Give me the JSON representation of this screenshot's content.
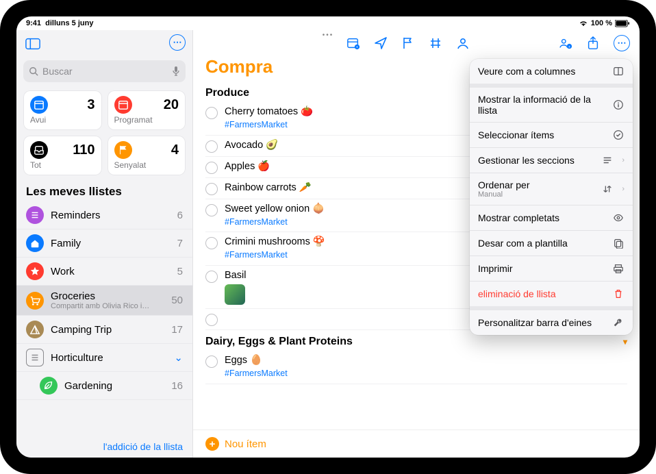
{
  "status": {
    "time": "9:41",
    "date": "dilluns 5 juny",
    "battery": "100 %"
  },
  "sidebar": {
    "search_placeholder": "Buscar",
    "smart": [
      {
        "label": "Avui",
        "count": 3,
        "color": "bg-blue",
        "icon": "calendar"
      },
      {
        "label": "Programat",
        "count": 20,
        "color": "bg-red",
        "icon": "calendar"
      },
      {
        "label": "Tot",
        "count": 110,
        "color": "bg-black",
        "icon": "tray"
      },
      {
        "label": "Senyalat",
        "count": 4,
        "color": "bg-orange",
        "icon": "flag"
      }
    ],
    "lists_heading": "Les meves llistes",
    "lists": [
      {
        "name": "Reminders",
        "count": 6,
        "color": "bg-purple",
        "icon": "list"
      },
      {
        "name": "Family",
        "count": 7,
        "color": "bg-blue",
        "icon": "home"
      },
      {
        "name": "Work",
        "count": 5,
        "color": "bg-red",
        "icon": "star"
      },
      {
        "name": "Groceries",
        "count": 50,
        "color": "bg-orange",
        "icon": "cart",
        "selected": true,
        "subtitle": "Compartit amb Olivia Rico i…"
      },
      {
        "name": "Camping Trip",
        "count": 17,
        "color": "bg-tan",
        "icon": "tent"
      },
      {
        "name": "Horticulture",
        "count": "",
        "folder": true
      },
      {
        "name": "Gardening",
        "count": 16,
        "color": "bg-green",
        "icon": "leaf",
        "indent": true
      }
    ],
    "add_list": "l'addició de la llista"
  },
  "list": {
    "title": "Compra",
    "new_item": "Nou ítem",
    "sections": [
      {
        "title": "Produce",
        "items": [
          {
            "text": "Cherry tomatoes 🍅",
            "tag": "#FarmersMarket"
          },
          {
            "text": "Avocado 🥑"
          },
          {
            "text": "Apples 🍎"
          },
          {
            "text": "Rainbow carrots 🥕"
          },
          {
            "text": "Sweet yellow onion 🧅",
            "tag": "#FarmersMarket"
          },
          {
            "text": "Crimini mushrooms 🍄",
            "tag": "#FarmersMarket"
          },
          {
            "text": "Basil",
            "thumb": true
          }
        ]
      },
      {
        "title": "Dairy, Eggs & Plant Proteins",
        "collapsible": true,
        "items": [
          {
            "text": "Eggs 🥚",
            "tag": "#FarmersMarket"
          }
        ]
      }
    ]
  },
  "menu": {
    "groups": [
      [
        {
          "label": "Veure com a columnes",
          "icon": "columns"
        }
      ],
      [
        {
          "label": "Mostrar la informació de la llista",
          "icon": "info"
        },
        {
          "label": "Seleccionar ítems",
          "icon": "check-circle"
        },
        {
          "label": "Gestionar les seccions",
          "icon": "sections",
          "chevron": true
        },
        {
          "label": "Ordenar per",
          "sub": "Manual",
          "icon": "sort",
          "chevron": true
        },
        {
          "label": "Mostrar completats",
          "icon": "eye"
        },
        {
          "label": "Desar com a plantilla",
          "icon": "template"
        },
        {
          "label": "Imprimir",
          "icon": "print"
        },
        {
          "label": "eliminació de llista",
          "icon": "trash",
          "danger": true
        }
      ],
      [
        {
          "label": "Personalitzar barra d'eines",
          "icon": "wrench"
        }
      ]
    ]
  }
}
